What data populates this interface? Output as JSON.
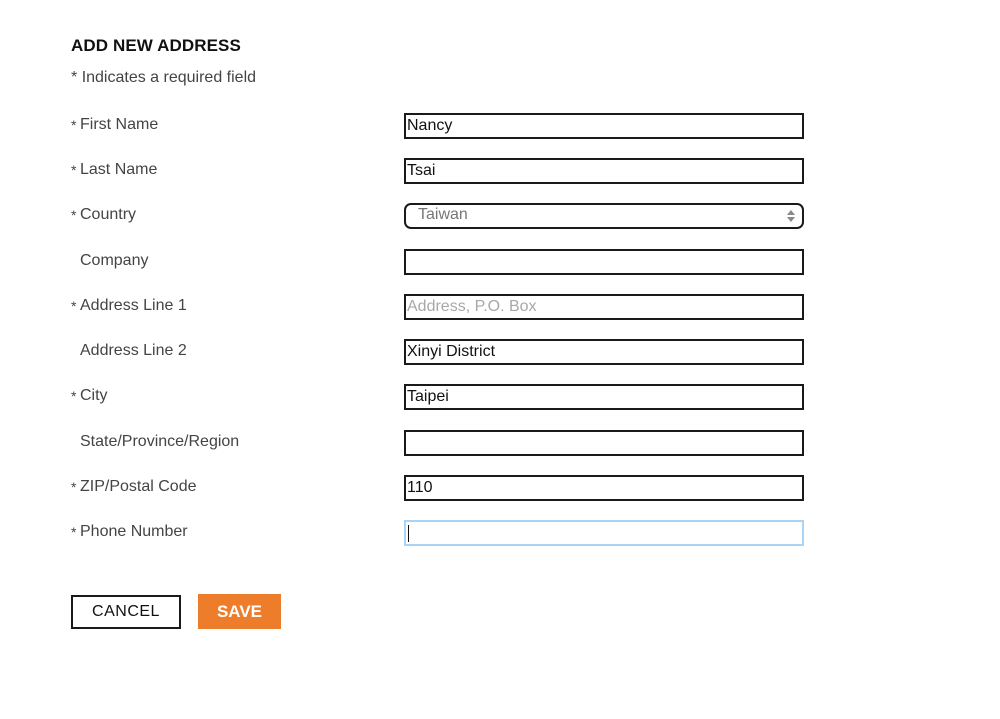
{
  "form": {
    "title": "ADD NEW ADDRESS",
    "required_note": "Indicates a required field",
    "required_marker": "*",
    "fields": [
      {
        "key": "first_name",
        "label": "First Name",
        "required": true,
        "type": "text",
        "value": "Nancy",
        "placeholder": ""
      },
      {
        "key": "last_name",
        "label": "Last Name",
        "required": true,
        "type": "text",
        "value": "Tsai",
        "placeholder": ""
      },
      {
        "key": "country",
        "label": "Country",
        "required": true,
        "type": "select",
        "value": "Taiwan",
        "icon": "up-down-arrows-icon"
      },
      {
        "key": "company",
        "label": "Company",
        "required": false,
        "type": "text",
        "value": "",
        "placeholder": ""
      },
      {
        "key": "address_line_1",
        "label": "Address Line 1",
        "required": true,
        "type": "text",
        "value": "",
        "placeholder": "Address, P.O. Box"
      },
      {
        "key": "address_line_2",
        "label": "Address Line 2",
        "required": false,
        "type": "text",
        "value": "Xinyi District",
        "placeholder": ""
      },
      {
        "key": "city",
        "label": "City",
        "required": true,
        "type": "text",
        "value": "Taipei",
        "placeholder": ""
      },
      {
        "key": "state",
        "label": "State/Province/Region",
        "required": false,
        "type": "text",
        "value": "",
        "placeholder": ""
      },
      {
        "key": "zip",
        "label": "ZIP/Postal Code",
        "required": true,
        "type": "text",
        "value": "110",
        "placeholder": ""
      },
      {
        "key": "phone",
        "label": "Phone Number",
        "required": true,
        "type": "text",
        "value": "",
        "placeholder": "",
        "focused": true
      }
    ]
  },
  "buttons": {
    "cancel_label": "CANCEL",
    "save_label": "SAVE"
  },
  "colors": {
    "accent": "#ed7d2a",
    "focus_border": "#a9d4f5",
    "placeholder": "#a8a8a8"
  }
}
